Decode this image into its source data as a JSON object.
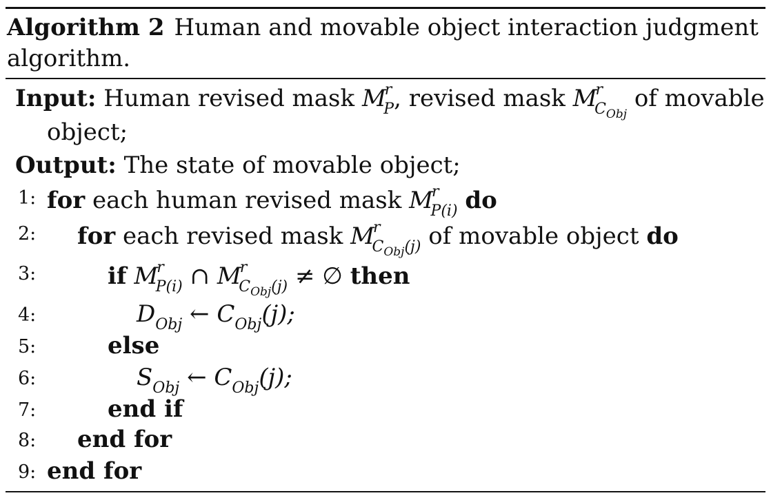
{
  "caption": {
    "label": "Algorithm 2",
    "title": "Human and movable object interaction judgment algorithm."
  },
  "input": {
    "label": "Input:",
    "text_1": "Human revised mask",
    "text_2": ", revised mask",
    "text_3": "of movable",
    "text_4": "object;"
  },
  "output": {
    "label": "Output:",
    "text": "The state of movable object;"
  },
  "keywords": {
    "for": "for",
    "do": "do",
    "if": "if",
    "then": "then",
    "else": "else",
    "end_if": "end if",
    "end_for": "end for"
  },
  "lines": [
    {
      "num": "1:",
      "text": "each human revised mask"
    },
    {
      "num": "2:",
      "text": "each revised mask",
      "tail": "of movable object"
    },
    {
      "num": "3:"
    },
    {
      "num": "4:"
    },
    {
      "num": "5:"
    },
    {
      "num": "6:"
    },
    {
      "num": "7:"
    },
    {
      "num": "8:"
    },
    {
      "num": "9:"
    }
  ],
  "math": {
    "M": "M",
    "r": "r",
    "P": "P",
    "C": "C",
    "Obj": "Obj",
    "Pi": "P(i)",
    "j_paren": "(j)",
    "cap": "∩",
    "neq_empty": "≠ ∅",
    "D": "D",
    "S": "S",
    "arrow": "←",
    "Cj_end": "(j);"
  }
}
